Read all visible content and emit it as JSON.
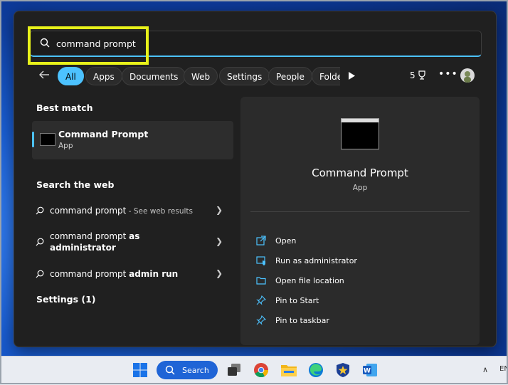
{
  "search": {
    "value": "command prompt"
  },
  "filters": [
    "All",
    "Apps",
    "Documents",
    "Web",
    "Settings",
    "People",
    "Folde"
  ],
  "points": "5",
  "more": "•••",
  "best_match": {
    "title": "Best match",
    "name": "Command Prompt",
    "sub": "App"
  },
  "search_web": {
    "title": "Search the web",
    "items": [
      {
        "prefix": "command prompt",
        "bold": "",
        "suffix": " - See web results"
      },
      {
        "prefix": "command prompt ",
        "bold": "as administrator",
        "suffix": ""
      },
      {
        "prefix": "command prompt ",
        "bold": "admin run",
        "suffix": ""
      }
    ]
  },
  "settings": {
    "title": "Settings (1)"
  },
  "preview": {
    "title": "Command Prompt",
    "sub": "App",
    "actions": [
      "Open",
      "Run as administrator",
      "Open file location",
      "Pin to Start",
      "Pin to taskbar"
    ]
  },
  "taskbar": {
    "search_label": "Search",
    "lang": "EN"
  },
  "colors": {
    "accent": "#4cc2ff",
    "highlight": "#e8f21a"
  }
}
